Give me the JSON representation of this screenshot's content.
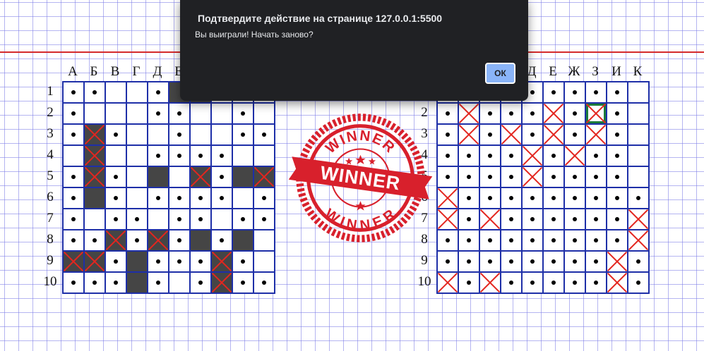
{
  "dialog": {
    "title": "Подтвердите действие на странице 127.0.0.1:5500",
    "message": "Вы выиграли! Начать заново?",
    "ok_label": "ОК"
  },
  "column_labels": [
    "А",
    "Б",
    "В",
    "Г",
    "Д",
    "Е",
    "Ж",
    "З",
    "И",
    "К"
  ],
  "row_labels": [
    "1",
    "2",
    "3",
    "4",
    "5",
    "6",
    "7",
    "8",
    "9",
    "10"
  ],
  "winner_stamp": {
    "text": "WINNER",
    "color": "#d8202c"
  },
  "colors": {
    "grid_line": "#1e2fa8",
    "ship": "#454545",
    "hit_mark": "#e3261f",
    "margin_line": "#d42a2a",
    "last_shot_border": "#1c7a3a",
    "dialog_bg": "#202124",
    "ok_button": "#8ab4f8"
  },
  "boards": {
    "player": {
      "legend": "S = ship, X = hit ship, o = miss, . = empty",
      "rows": [
        "oo..oSS...",
        "o...oo..o.",
        "oXo..o..oo",
        ".X..oooo..",
        "oXo.S.XoSX",
        "oSo.oooo.o",
        "o.oo.oo.oo",
        "ooXoXoSoS",
        "XXoSoooXo.",
        "oooSo.oXoo"
      ]
    },
    "opponent": {
      "legend": "X = hit, o = miss, G = last shot hit, . = empty",
      "rows": [
        "..ooooooo.",
        "oXoooXoGo.",
        "oXoXoXoXo.",
        "ooooXoXoo.",
        "ooooXoooo.",
        "Xooooooooo",
        "XoXooooooX",
        "oooooooooX",
        "ooooooooXo",
        "XoXoooooXo"
      ]
    }
  }
}
